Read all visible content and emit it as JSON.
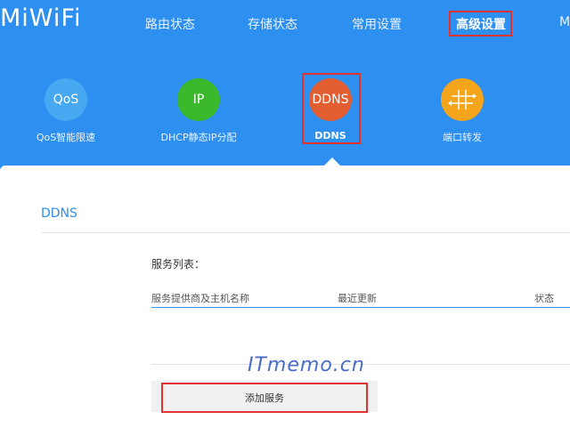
{
  "logo": "MiWiFi",
  "nav": {
    "items": [
      {
        "label": "路由状态"
      },
      {
        "label": "存储状态"
      },
      {
        "label": "常用设置"
      },
      {
        "label": "高级设置"
      },
      {
        "label": "M"
      }
    ]
  },
  "features": [
    {
      "icon_text": "QoS",
      "label": "QoS智能限速",
      "color": "#47a9f2"
    },
    {
      "icon_text": "IP",
      "label": "DHCP静态IP分配",
      "color": "#3cb82c"
    },
    {
      "icon_text": "DDNS",
      "label": "DDNS",
      "color": "#e35f31"
    },
    {
      "icon_text": "",
      "label": "端口转发",
      "color": "#f5a51c"
    }
  ],
  "page": {
    "section_title": "DDNS",
    "list_title": "服务列表：",
    "columns": [
      "服务提供商及主机名称",
      "最近更新",
      "状态"
    ],
    "watermark": "ITmemo.cn",
    "add_button": "添加服务"
  },
  "colors": {
    "accent": "#2d8ff0",
    "highlight": "#e0322f"
  }
}
